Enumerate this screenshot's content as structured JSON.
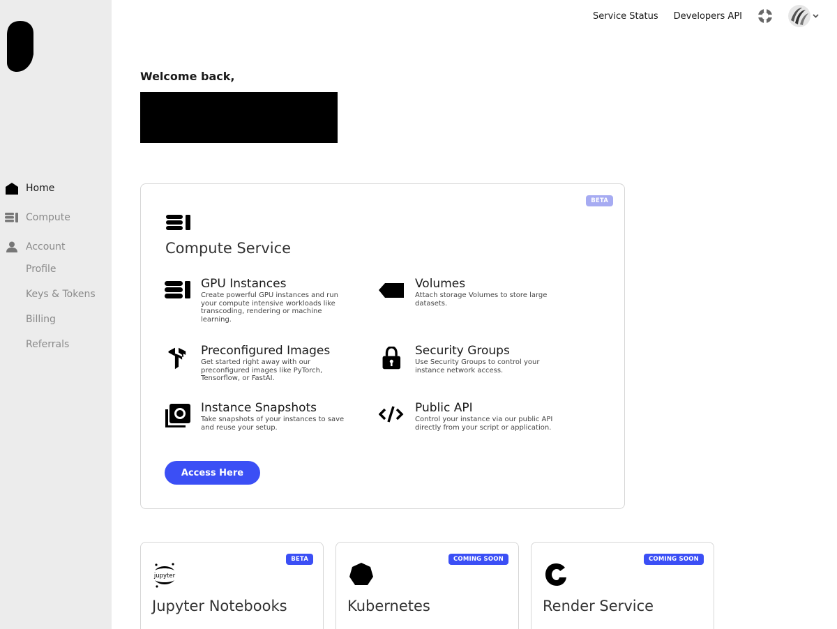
{
  "topbar": {
    "service_status": "Service Status",
    "developers_api": "Developers API"
  },
  "sidebar": {
    "items": [
      {
        "label": "Home",
        "icon": "home-icon",
        "active": true
      },
      {
        "label": "Compute",
        "icon": "server-icon",
        "active": false
      },
      {
        "label": "Account",
        "icon": "user-icon",
        "active": false
      }
    ],
    "sub_items": [
      "Profile",
      "Keys & Tokens",
      "Billing",
      "Referrals"
    ]
  },
  "welcome": {
    "text": "Welcome back,"
  },
  "compute_card": {
    "badge": "BETA",
    "title": "Compute Service",
    "features": [
      {
        "title": "GPU Instances",
        "desc": "Create powerful GPU instances and run your compute intensive workloads like transcoding, rendering or machine learning.",
        "icon": "server-stack-icon"
      },
      {
        "title": "Volumes",
        "desc": "Attach storage Volumes to store large datasets.",
        "icon": "tag-icon"
      },
      {
        "title": "Preconfigured Images",
        "desc": "Get started right away with our preconfigured images like PyTorch, Tensorflow, or FastAI.",
        "icon": "tensorflow-icon"
      },
      {
        "title": "Security Groups",
        "desc": "Use Security Groups to control your instance network access.",
        "icon": "lock-icon"
      },
      {
        "title": "Instance Snapshots",
        "desc": "Take snapshots of your instances to save and reuse your setup.",
        "icon": "camera-icon"
      },
      {
        "title": "Public API",
        "desc": "Control your instance via our public API directly from your script or application.",
        "icon": "code-icon"
      }
    ],
    "button": "Access Here"
  },
  "small_cards": [
    {
      "badge": "BETA",
      "title": "Jupyter Notebooks",
      "icon": "jupyter-icon",
      "icon_text": "jupyter"
    },
    {
      "badge": "COMING SOON",
      "title": "Kubernetes",
      "icon": "heptagon-icon"
    },
    {
      "badge": "COMING SOON",
      "title": "Render Service",
      "icon": "render-icon"
    }
  ],
  "colors": {
    "accent": "#3b4ff5",
    "beta_badge": "#a6abf2",
    "sidebar_bg": "#ececec"
  }
}
